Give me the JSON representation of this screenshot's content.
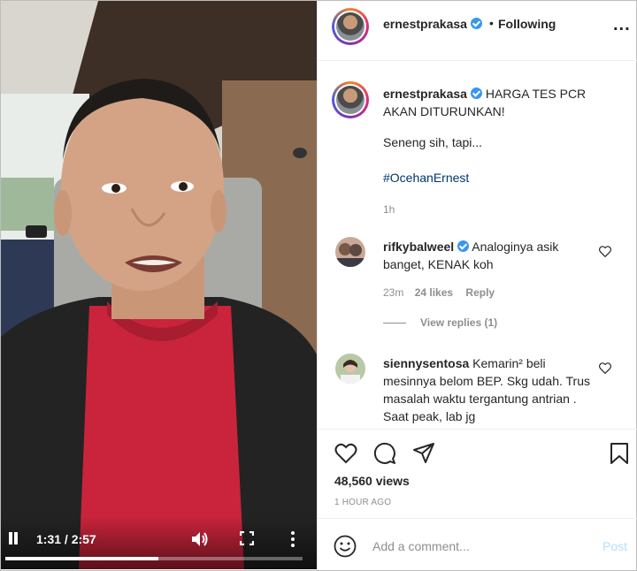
{
  "post": {
    "username": "ernestprakasa",
    "separator": "•",
    "follow_status": "Following",
    "more_label": "..."
  },
  "caption": {
    "username": "ernestprakasa",
    "headline": "HARGA TES PCR AKAN DITURUNKAN!",
    "line2": "Seneng sih, tapi...",
    "hashtag": "#OcehanErnest",
    "age": "1h"
  },
  "comments": [
    {
      "username": "rifkybalweel",
      "text": "Analoginya asik banget, KENAK koh",
      "age": "23m",
      "likes": "24 likes",
      "reply": "Reply",
      "view_replies": "View replies (1)"
    },
    {
      "username": "siennysentosa",
      "text": "Kemarin² beli mesinnya belom BEP. Skg udah. Trus masalah waktu tergantung antrian . Saat peak, lab jg"
    }
  ],
  "stats": {
    "views": "48,560 views",
    "posted": "1 HOUR AGO"
  },
  "add_comment": {
    "placeholder": "Add a comment...",
    "post_label": "Post"
  },
  "video": {
    "time": "1:31 / 2:57",
    "progress": 0.514
  }
}
